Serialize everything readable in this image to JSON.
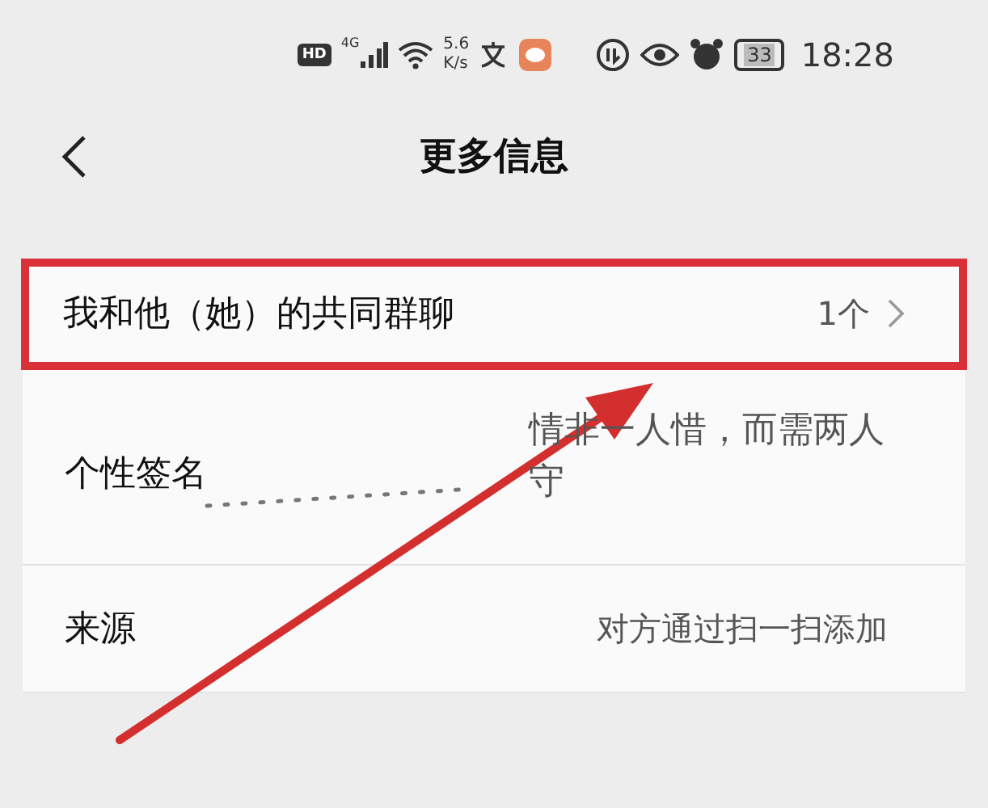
{
  "status_bar": {
    "hd": "HD",
    "network": "4G",
    "speed_value": "5.6",
    "speed_unit": "K/s",
    "battery": "33",
    "time": "18:28"
  },
  "header": {
    "title": "更多信息"
  },
  "rows": [
    {
      "kind": "link",
      "label": "我和他（她）的共同群聊",
      "value": "1个",
      "highlighted": true
    },
    {
      "kind": "text",
      "label": "个性签名",
      "value": "情非一人惜，而需两人守",
      "highlighted": false
    },
    {
      "kind": "text",
      "label": "来源",
      "value": "对方通过扫一扫添加",
      "highlighted": false
    }
  ]
}
